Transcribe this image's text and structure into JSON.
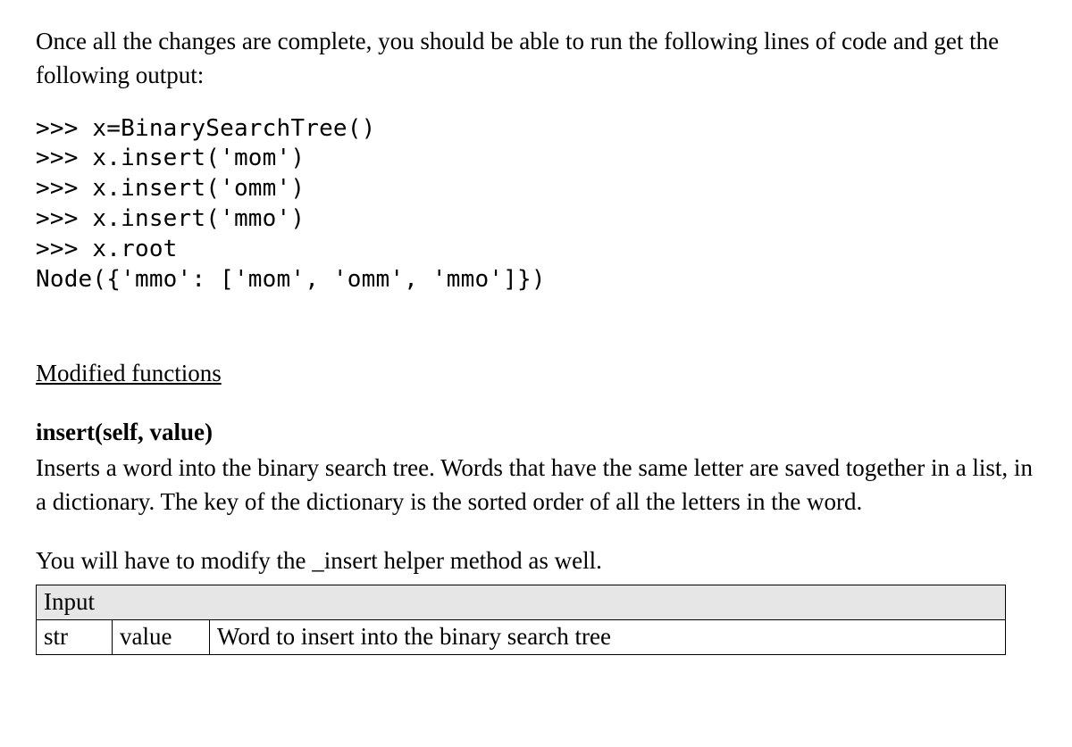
{
  "intro": "Once all the changes are complete, you should be able to run the following lines of code and get the following output:",
  "code_lines": [
    ">>> x=BinarySearchTree()",
    ">>> x.insert('mom')",
    ">>> x.insert('omm')",
    ">>> x.insert('mmo')",
    ">>> x.root",
    "Node({'mmo': ['mom', 'omm', 'mmo']})"
  ],
  "section_heading": "Modified functions",
  "fn": {
    "signature": "insert(self, value)",
    "description": "Inserts a word into the binary search tree. Words that have the same letter are saved together in a list, in a dictionary. The key of the dictionary is the sorted order of all the letters in the word.",
    "pre_table": "You will have to modify the _insert helper method as well.",
    "table": {
      "header": "Input",
      "rows": [
        {
          "type": "str",
          "name": "value",
          "desc": "Word to insert into the binary search tree"
        }
      ]
    }
  }
}
